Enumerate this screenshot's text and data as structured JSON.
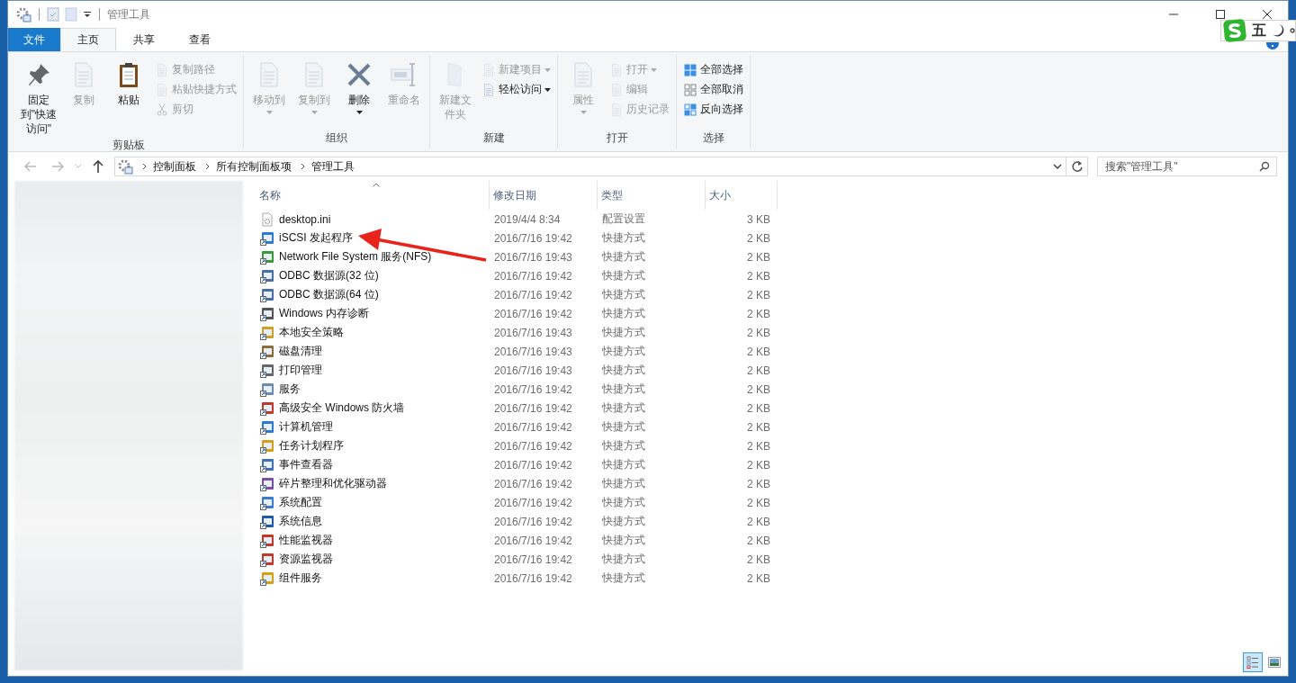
{
  "window": {
    "title": "管理工具"
  },
  "ribbon_tabs": [
    {
      "label": "文件",
      "kind": "file",
      "selected": false
    },
    {
      "label": "主页",
      "kind": "tab",
      "selected": true
    },
    {
      "label": "共享",
      "kind": "tab",
      "selected": false
    },
    {
      "label": "查看",
      "kind": "tab",
      "selected": false
    }
  ],
  "ribbon_groups": [
    {
      "label": "剪贴板",
      "items": [
        {
          "label": "固定到\"快速访问\"",
          "kind": "large",
          "disabled": false,
          "dropdown": false
        },
        {
          "label": "复制",
          "kind": "large",
          "disabled": true,
          "dropdown": false
        },
        {
          "label": "粘贴",
          "kind": "large",
          "disabled": false,
          "dropdown": false
        },
        {
          "label": "复制路径",
          "kind": "small",
          "disabled": true,
          "dropdown": false
        },
        {
          "label": "粘贴快捷方式",
          "kind": "small",
          "disabled": true,
          "dropdown": false
        },
        {
          "label": "剪切",
          "kind": "small",
          "disabled": true,
          "dropdown": false
        }
      ]
    },
    {
      "label": "组织",
      "items": [
        {
          "label": "移动到",
          "kind": "large",
          "disabled": true,
          "dropdown": true
        },
        {
          "label": "复制到",
          "kind": "large",
          "disabled": true,
          "dropdown": true
        },
        {
          "label": "删除",
          "kind": "large",
          "disabled": false,
          "dropdown": true
        },
        {
          "label": "重命名",
          "kind": "large",
          "disabled": true,
          "dropdown": false
        }
      ]
    },
    {
      "label": "新建",
      "items": [
        {
          "label": "新建文件夹",
          "kind": "large",
          "disabled": true,
          "dropdown": false
        },
        {
          "label": "新建项目",
          "kind": "small",
          "disabled": true,
          "dropdown": true
        },
        {
          "label": "轻松访问",
          "kind": "small",
          "disabled": false,
          "dropdown": true
        }
      ]
    },
    {
      "label": "打开",
      "items": [
        {
          "label": "属性",
          "kind": "large",
          "disabled": true,
          "dropdown": true
        },
        {
          "label": "打开",
          "kind": "small",
          "disabled": true,
          "dropdown": true
        },
        {
          "label": "编辑",
          "kind": "small",
          "disabled": true,
          "dropdown": false
        },
        {
          "label": "历史记录",
          "kind": "small",
          "disabled": true,
          "dropdown": false
        }
      ]
    },
    {
      "label": "选择",
      "items": [
        {
          "label": "全部选择",
          "kind": "small",
          "disabled": false,
          "dropdown": false
        },
        {
          "label": "全部取消",
          "kind": "small",
          "disabled": false,
          "dropdown": false
        },
        {
          "label": "反向选择",
          "kind": "small",
          "disabled": false,
          "dropdown": false
        }
      ]
    }
  ],
  "address_bar": {
    "breadcrumbs": [
      "控制面板",
      "所有控制面板项",
      "管理工具"
    ]
  },
  "search": {
    "placeholder": "搜索\"管理工具\""
  },
  "file_list": {
    "columns": [
      {
        "label": "名称",
        "sorted": true
      },
      {
        "label": "修改日期",
        "sorted": false
      },
      {
        "label": "类型",
        "sorted": false
      },
      {
        "label": "大小",
        "sorted": false
      }
    ],
    "rows": [
      {
        "name": "desktop.ini",
        "date": "2019/4/4 8:34",
        "type": "配置设置",
        "size": "3 KB",
        "kind": "settings-file"
      },
      {
        "name": "iSCSI 发起程序",
        "date": "2016/7/16 19:42",
        "type": "快捷方式",
        "size": "2 KB",
        "kind": "shortcut"
      },
      {
        "name": "Network File System 服务(NFS)",
        "date": "2016/7/16 19:43",
        "type": "快捷方式",
        "size": "2 KB",
        "kind": "shortcut"
      },
      {
        "name": "ODBC 数据源(32 位)",
        "date": "2016/7/16 19:42",
        "type": "快捷方式",
        "size": "2 KB",
        "kind": "shortcut"
      },
      {
        "name": "ODBC 数据源(64 位)",
        "date": "2016/7/16 19:42",
        "type": "快捷方式",
        "size": "2 KB",
        "kind": "shortcut"
      },
      {
        "name": "Windows 内存诊断",
        "date": "2016/7/16 19:42",
        "type": "快捷方式",
        "size": "2 KB",
        "kind": "shortcut"
      },
      {
        "name": "本地安全策略",
        "date": "2016/7/16 19:43",
        "type": "快捷方式",
        "size": "2 KB",
        "kind": "shortcut"
      },
      {
        "name": "磁盘清理",
        "date": "2016/7/16 19:43",
        "type": "快捷方式",
        "size": "2 KB",
        "kind": "shortcut"
      },
      {
        "name": "打印管理",
        "date": "2016/7/16 19:43",
        "type": "快捷方式",
        "size": "2 KB",
        "kind": "shortcut"
      },
      {
        "name": "服务",
        "date": "2016/7/16 19:42",
        "type": "快捷方式",
        "size": "2 KB",
        "kind": "shortcut"
      },
      {
        "name": "高级安全 Windows 防火墙",
        "date": "2016/7/16 19:42",
        "type": "快捷方式",
        "size": "2 KB",
        "kind": "shortcut"
      },
      {
        "name": "计算机管理",
        "date": "2016/7/16 19:42",
        "type": "快捷方式",
        "size": "2 KB",
        "kind": "shortcut"
      },
      {
        "name": "任务计划程序",
        "date": "2016/7/16 19:42",
        "type": "快捷方式",
        "size": "2 KB",
        "kind": "shortcut"
      },
      {
        "name": "事件查看器",
        "date": "2016/7/16 19:42",
        "type": "快捷方式",
        "size": "2 KB",
        "kind": "shortcut"
      },
      {
        "name": "碎片整理和优化驱动器",
        "date": "2016/7/16 19:42",
        "type": "快捷方式",
        "size": "2 KB",
        "kind": "shortcut"
      },
      {
        "name": "系统配置",
        "date": "2016/7/16 19:42",
        "type": "快捷方式",
        "size": "2 KB",
        "kind": "shortcut"
      },
      {
        "name": "系统信息",
        "date": "2016/7/16 19:42",
        "type": "快捷方式",
        "size": "2 KB",
        "kind": "shortcut"
      },
      {
        "name": "性能监视器",
        "date": "2016/7/16 19:42",
        "type": "快捷方式",
        "size": "2 KB",
        "kind": "shortcut"
      },
      {
        "name": "资源监视器",
        "date": "2016/7/16 19:42",
        "type": "快捷方式",
        "size": "2 KB",
        "kind": "shortcut"
      },
      {
        "name": "组件服务",
        "date": "2016/7/16 19:42",
        "type": "快捷方式",
        "size": "2 KB",
        "kind": "shortcut"
      }
    ]
  },
  "view_buttons": [
    {
      "kind": "details",
      "selected": true
    },
    {
      "kind": "large-icons",
      "selected": false
    }
  ],
  "ime_toolbar": {
    "mode": "五"
  }
}
